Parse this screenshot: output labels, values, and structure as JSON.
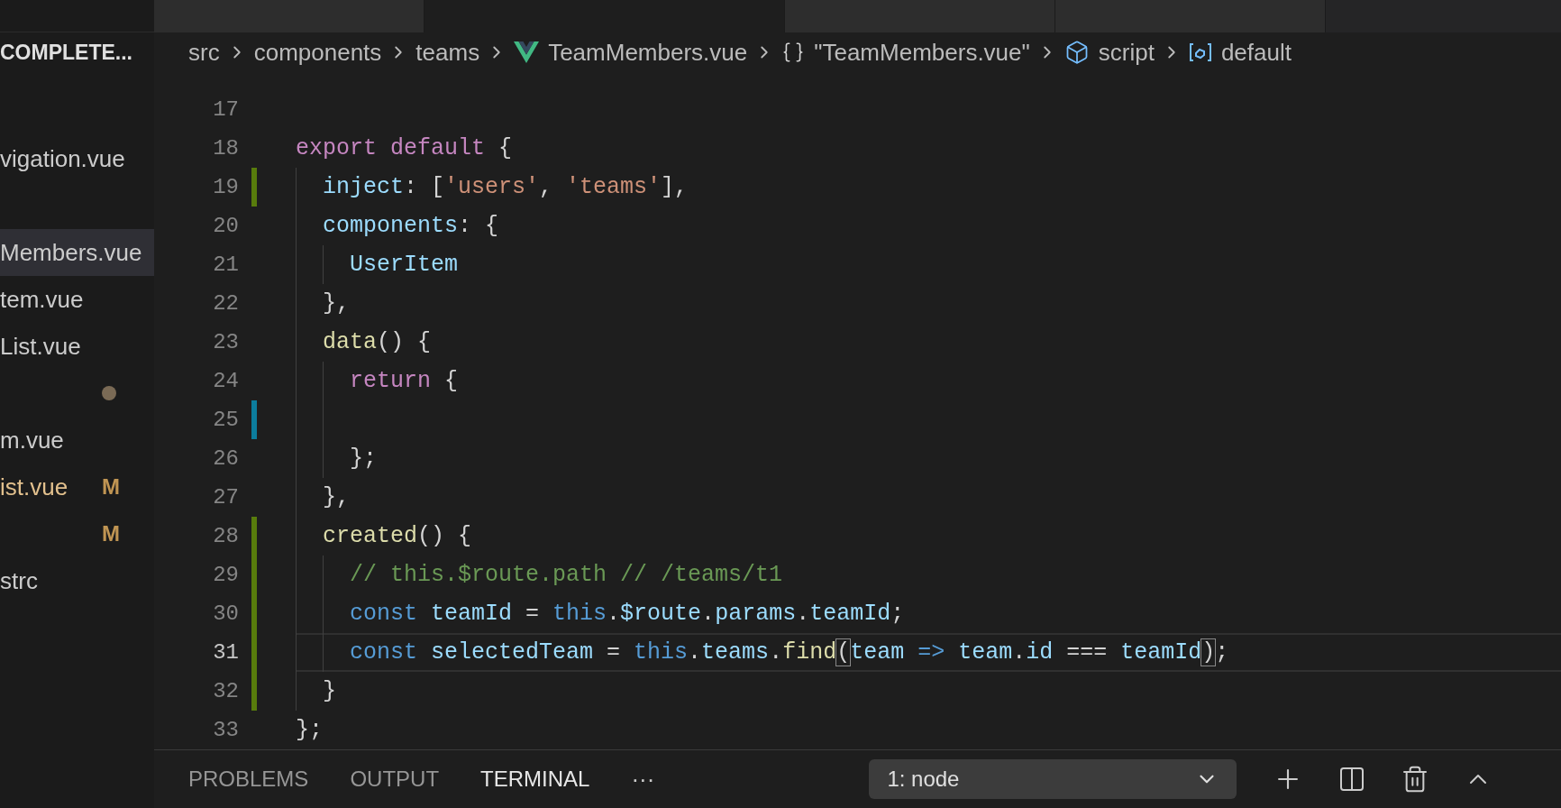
{
  "editor_tabs": [
    {
      "selected": false
    },
    {
      "selected": true
    },
    {
      "selected": false
    },
    {
      "selected": false
    }
  ],
  "sidebar": {
    "title": "COMPLETE...",
    "items": [
      {
        "kind": "blank"
      },
      {
        "kind": "file",
        "label": "vigation.vue",
        "selected": false,
        "modified": false
      },
      {
        "kind": "blank"
      },
      {
        "kind": "file",
        "label": "Members.vue",
        "selected": true,
        "modified": false
      },
      {
        "kind": "file",
        "label": "tem.vue",
        "selected": false,
        "modified": false
      },
      {
        "kind": "file",
        "label": "List.vue",
        "selected": false,
        "modified": false
      },
      {
        "kind": "dot"
      },
      {
        "kind": "file",
        "label": "m.vue",
        "selected": false,
        "modified": false
      },
      {
        "kind": "file",
        "label": "ist.vue",
        "selected": false,
        "modified": true,
        "badge": "M"
      },
      {
        "kind": "badge",
        "badge": "M"
      },
      {
        "kind": "file",
        "label": "strc",
        "selected": false,
        "modified": false
      }
    ]
  },
  "breadcrumbs": [
    {
      "kind": "folder",
      "label": "src"
    },
    {
      "kind": "folder",
      "label": "components"
    },
    {
      "kind": "folder",
      "label": "teams"
    },
    {
      "kind": "vue",
      "label": "TeamMembers.vue"
    },
    {
      "kind": "object",
      "label": "\"TeamMembers.vue\""
    },
    {
      "kind": "module",
      "label": "script"
    },
    {
      "kind": "variable",
      "label": "default"
    }
  ],
  "code": {
    "lines": [
      {
        "number": "17",
        "current": false
      },
      {
        "number": "18",
        "current": false,
        "tokens": [
          {
            "kind": "keyword",
            "text": "export"
          },
          {
            "kind": "keyword",
            "text": " default"
          },
          {
            "kind": "plain",
            "text": " {"
          }
        ],
        "children": [
          {
            "number": "19",
            "color": "#587c0c",
            "current": false,
            "tokens": [
              {
                "kind": "variable",
                "text": "inject"
              },
              {
                "kind": "plain",
                "text": ": ["
              },
              {
                "kind": "string",
                "text": "'users'"
              },
              {
                "kind": "plain",
                "text": ", "
              },
              {
                "kind": "string",
                "text": "'teams'"
              },
              {
                "kind": "plain",
                "text": "],"
              }
            ]
          },
          {
            "number": "20",
            "current": false,
            "tokens": [
              {
                "kind": "variable",
                "text": "components"
              },
              {
                "kind": "plain",
                "text": ": {"
              }
            ],
            "children": [
              {
                "number": "21",
                "current": false,
                "tokens": [
                  {
                    "kind": "variable",
                    "text": "UserItem"
                  }
                ]
              }
            ]
          },
          {
            "number": "22",
            "current": false,
            "tokens": [
              {
                "kind": "plain",
                "text": "},"
              }
            ]
          },
          {
            "number": "23",
            "current": false,
            "tokens": [
              {
                "kind": "function",
                "text": "data"
              },
              {
                "kind": "plain",
                "text": "() {"
              }
            ],
            "children": [
              {
                "number": "24",
                "current": false,
                "tokens": [
                  {
                    "kind": "keyword",
                    "text": "return"
                  },
                  {
                    "kind": "plain",
                    "text": " {"
                  }
                ]
              },
              {
                "number": "25",
                "color": "#0c7d9d",
                "current": false
              },
              {
                "number": "26",
                "current": false,
                "tokens": [
                  {
                    "kind": "plain",
                    "text": "};"
                  }
                ]
              }
            ]
          },
          {
            "number": "27",
            "current": false,
            "tokens": [
              {
                "kind": "plain",
                "text": "},"
              }
            ]
          },
          {
            "number": "28",
            "color": "#587c0c",
            "current": false,
            "tokens": [
              {
                "kind": "function",
                "text": "created"
              },
              {
                "kind": "plain",
                "text": "() {"
              }
            ],
            "children": [
              {
                "number": "29",
                "color": "#587c0c",
                "current": false,
                "tokens": [
                  {
                    "kind": "comment",
                    "text": "// this.$route.path // /teams/t1"
                  }
                ]
              },
              {
                "number": "30",
                "color": "#587c0c",
                "current": false,
                "tokens": [
                  {
                    "kind": "storage",
                    "text": "const"
                  },
                  {
                    "kind": "variable",
                    "text": " teamId"
                  },
                  {
                    "kind": "plain",
                    "text": " = "
                  },
                  {
                    "kind": "storage",
                    "text": "this"
                  },
                  {
                    "kind": "plain",
                    "text": "."
                  },
                  {
                    "kind": "variable",
                    "text": "$route"
                  },
                  {
                    "kind": "plain",
                    "text": "."
                  },
                  {
                    "kind": "variable",
                    "text": "params"
                  },
                  {
                    "kind": "plain",
                    "text": "."
                  },
                  {
                    "kind": "variable",
                    "text": "teamId"
                  },
                  {
                    "kind": "plain",
                    "text": ";"
                  }
                ]
              },
              {
                "number": "31",
                "color": "#587c0c",
                "current": true,
                "tokens": [
                  {
                    "kind": "storage",
                    "text": "const"
                  },
                  {
                    "kind": "variable",
                    "text": " selectedTeam"
                  },
                  {
                    "kind": "plain",
                    "text": " = "
                  },
                  {
                    "kind": "storage",
                    "text": "this"
                  },
                  {
                    "kind": "plain",
                    "text": "."
                  },
                  {
                    "kind": "variable",
                    "text": "teams"
                  },
                  {
                    "kind": "plain",
                    "text": "."
                  },
                  {
                    "kind": "function",
                    "text": "find"
                  },
                  {
                    "kind": "bracket",
                    "text": "("
                  },
                  {
                    "kind": "variable",
                    "text": "team"
                  },
                  {
                    "kind": "storage",
                    "text": " =>"
                  },
                  {
                    "kind": "variable",
                    "text": " team"
                  },
                  {
                    "kind": "plain",
                    "text": "."
                  },
                  {
                    "kind": "variable",
                    "text": "id"
                  },
                  {
                    "kind": "plain",
                    "text": " === "
                  },
                  {
                    "kind": "variable",
                    "text": "teamId"
                  },
                  {
                    "kind": "bracket",
                    "text": ")"
                  },
                  {
                    "kind": "plain",
                    "text": ";"
                  }
                ]
              }
            ]
          },
          {
            "number": "32",
            "color": "#587c0c",
            "current": false,
            "tokens": [
              {
                "kind": "plain",
                "text": "}"
              }
            ]
          }
        ]
      },
      {
        "number": "33",
        "current": false,
        "tokens": [
          {
            "kind": "plain",
            "text": "};"
          }
        ]
      }
    ]
  },
  "panel": {
    "tabs": [
      {
        "label": "PROBLEMS",
        "selected": false
      },
      {
        "label": "OUTPUT",
        "selected": false
      },
      {
        "label": "TERMINAL",
        "selected": true
      }
    ],
    "more": "···",
    "terminal_select": "1: node"
  }
}
